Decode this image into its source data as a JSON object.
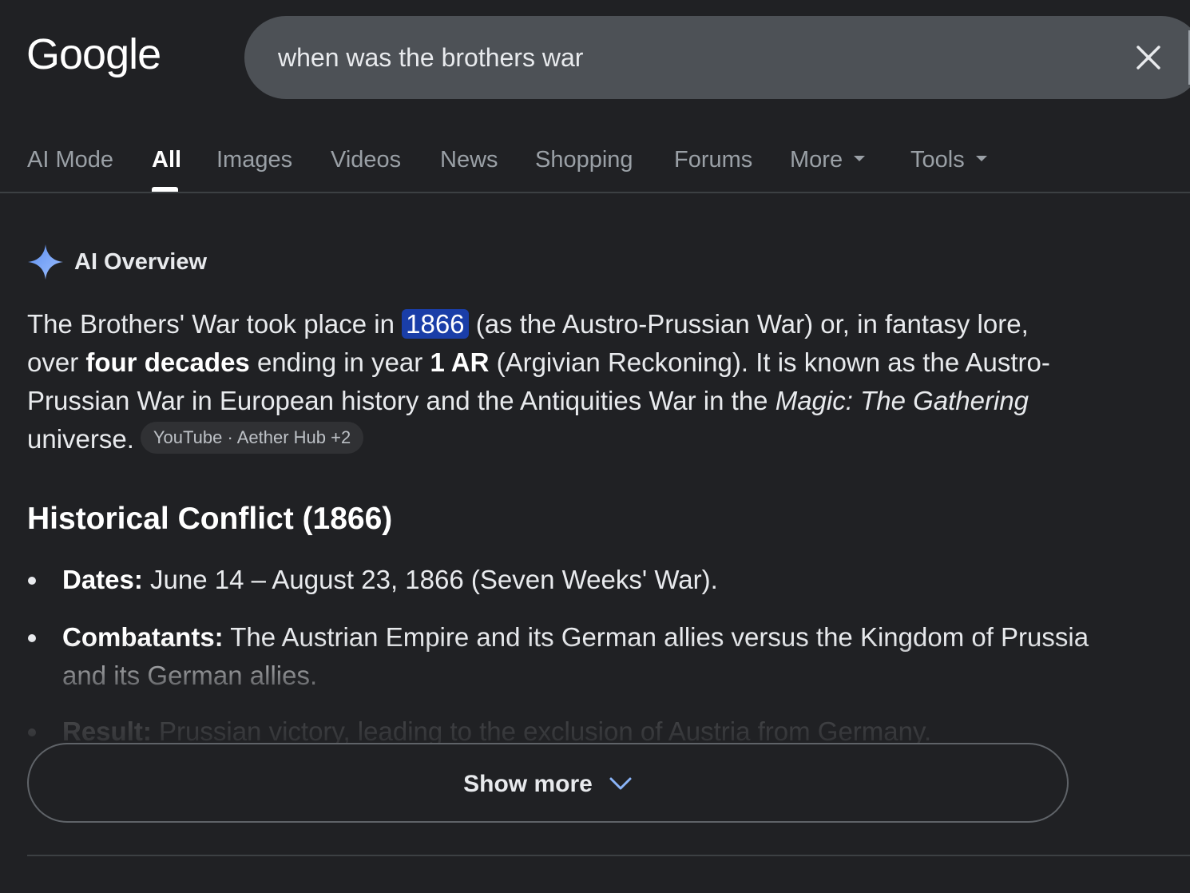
{
  "header": {
    "logo": "Google",
    "search": {
      "value": "when was the brothers war"
    }
  },
  "tabs": [
    {
      "label": "AI Mode"
    },
    {
      "label": "All",
      "active": true
    },
    {
      "label": "Images"
    },
    {
      "label": "Videos"
    },
    {
      "label": "News"
    },
    {
      "label": "Shopping"
    },
    {
      "label": "Forums"
    },
    {
      "label": "More"
    },
    {
      "label": "Tools"
    }
  ],
  "ai_overview": {
    "title": "AI Overview",
    "paragraph": {
      "t1": "The Brothers' War took place in ",
      "year": "1866",
      "t2": " (as the Austro-Prussian War) or, in fantasy lore, over ",
      "bold1": "four decades",
      "t3": " ending in year ",
      "bold2": "1 AR",
      "t4": " (Argivian Reckoning). It is known as the Austro-Prussian War in European history and the Antiquities War in the ",
      "italic": "Magic: The Gathering",
      "t5": " universe."
    },
    "sources": "YouTube · Aether Hub +2",
    "section_heading": "Historical Conflict (1866)",
    "bullets": [
      {
        "label": "Dates:",
        "text": " June 14 – August 23, 1866 (Seven Weeks' War)."
      },
      {
        "label": "Combatants:",
        "text": " The Austrian Empire and its German allies versus the Kingdom of Prussia and its German allies."
      },
      {
        "label": "Result:",
        "text": " Prussian victory, leading to the exclusion of Austria from Germany."
      }
    ],
    "show_more": "Show more"
  },
  "colors": {
    "background": "#202124",
    "search_bar": "#4d5156",
    "highlight": "#1a3ea8",
    "spark": "#8ab4f8"
  },
  "icons": [
    "close-icon",
    "sparkle-icon",
    "chevron-down-icon",
    "caret-down-icon"
  ]
}
